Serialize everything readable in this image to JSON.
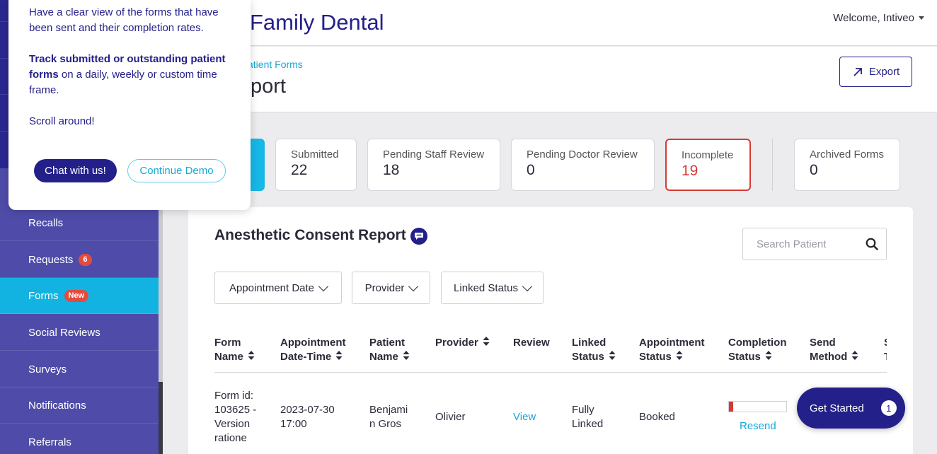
{
  "header": {
    "brand_partial": "Family Dental",
    "welcome": "Welcome, Intiveo"
  },
  "subheader": {
    "breadcrumb_partial": "atient Forms",
    "title_partial": "port",
    "export_label": "Export"
  },
  "sidebar": {
    "items": [
      {
        "label": "Recalls"
      },
      {
        "label": "Requests",
        "badge": "6"
      },
      {
        "label": "Forms",
        "badge": "New",
        "active": true
      },
      {
        "label": "Social Reviews"
      },
      {
        "label": "Surveys"
      },
      {
        "label": "Notifications"
      },
      {
        "label": "Referrals"
      }
    ]
  },
  "stats": [
    {
      "label": "Submitted",
      "value": "22"
    },
    {
      "label": "Pending Staff Review",
      "value": "18"
    },
    {
      "label": "Pending Doctor Review",
      "value": "0"
    },
    {
      "label": "Incomplete",
      "value": "19",
      "alert": true
    },
    {
      "label": "Archived Forms",
      "value": "0"
    }
  ],
  "report": {
    "title": "Anesthetic Consent Report",
    "search_placeholder": "Search Patient",
    "filters": [
      "Appointment Date",
      "Provider",
      "Linked Status"
    ],
    "columns": [
      {
        "l1": "Form",
        "l2": "Name"
      },
      {
        "l1": "Appointment",
        "l2": "Date-Time"
      },
      {
        "l1": "Patient",
        "l2": "Name"
      },
      {
        "l1": "Provider",
        "l2": ""
      },
      {
        "l1": "Review",
        "l2": ""
      },
      {
        "l1": "Linked",
        "l2": "Status"
      },
      {
        "l1": "Appointment",
        "l2": "Status"
      },
      {
        "l1": "Completion",
        "l2": "Status"
      },
      {
        "l1": "Send",
        "l2": "Method"
      },
      {
        "l1": "S",
        "l2": "T"
      }
    ],
    "row": {
      "form_name": [
        "Form id:",
        "103625 -",
        "Version",
        "ratione"
      ],
      "datetime": [
        "2023-07-30",
        "17:00"
      ],
      "patient": [
        "Benjami",
        "n Gros"
      ],
      "provider": "Olivier",
      "review": "View",
      "linked": [
        "Fully",
        "Linked"
      ],
      "appointment_status": "Booked",
      "completion_progress": 0.08,
      "resend": "Resend"
    }
  },
  "popover": {
    "p1": "Have a clear view of the forms that have been sent and their completion rates.",
    "p2_strong": "Track submitted or outstanding patient forms",
    "p2_rest": " on a daily, weekly or custom time frame.",
    "p3": "Scroll around!",
    "chat_label": "Chat with us!",
    "demo_label": "Continue Demo"
  },
  "get_started": {
    "label": "Get Started",
    "count": "1"
  },
  "colors": {
    "primary": "#23208a",
    "accent": "#12b3e0",
    "alert": "#d63a34",
    "sidebar": "#4e4ca8"
  }
}
